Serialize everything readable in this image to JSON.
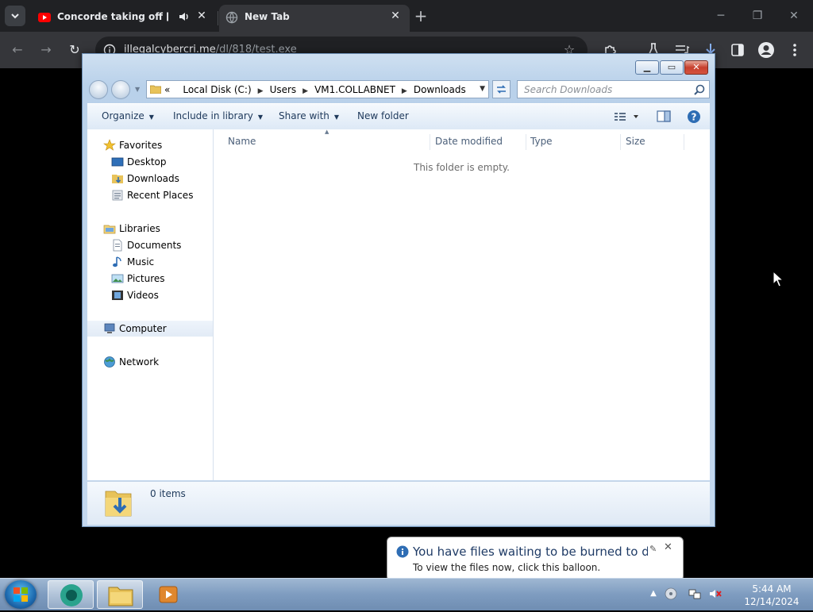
{
  "browser": {
    "tabs": [
      {
        "title": "Concorde taking off [Delet",
        "active": false,
        "audio": true
      },
      {
        "title": "New Tab",
        "active": true
      }
    ],
    "url_host": "illegalcybercri.me",
    "url_path": "/dl/818/test.exe"
  },
  "explorer": {
    "breadcrumbs": [
      "Local Disk (C:)",
      "Users",
      "VM1.COLLABNET",
      "Downloads"
    ],
    "breadcrumb_prefix": "«",
    "search_placeholder": "Search Downloads",
    "commands": {
      "organize": "Organize",
      "include_in_library": "Include in library",
      "share_with": "Share with",
      "new_folder": "New folder"
    },
    "nav_pane": {
      "favorites": "Favorites",
      "desktop": "Desktop",
      "downloads": "Downloads",
      "recent_places": "Recent Places",
      "libraries": "Libraries",
      "documents": "Documents",
      "music": "Music",
      "pictures": "Pictures",
      "videos": "Videos",
      "computer": "Computer",
      "network": "Network"
    },
    "columns": {
      "name": "Name",
      "date_modified": "Date modified",
      "type": "Type",
      "size": "Size"
    },
    "empty_message": "This folder is empty.",
    "item_count": "0 items"
  },
  "balloon": {
    "title": "You have files waiting to be burned to disc",
    "text": "To view the files now, click this balloon."
  },
  "taskbar": {
    "time": "5:44 AM",
    "date": "12/14/2024"
  }
}
